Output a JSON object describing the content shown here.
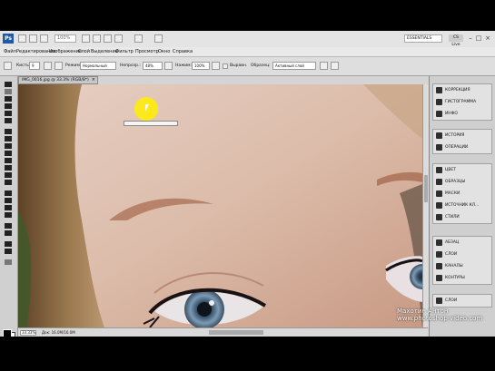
{
  "appbar": {
    "logo": "Ps",
    "zoom": "100%",
    "workspace": "ESSENTIALS",
    "cs_live": "CS Live"
  },
  "menu": [
    "Файл",
    "Редактирование",
    "Изображение",
    "Слой",
    "Выделение",
    "Фильтр",
    "Просмотр",
    "Окно",
    "Справка"
  ],
  "options": {
    "brush_label": "Кисть:",
    "brush_size": "9",
    "mode_label": "Режим:",
    "mode_value": "Нормальный",
    "opacity_label": "Непрозр.:",
    "opacity_value": "48%",
    "flow_label": "Нажим:",
    "flow_value": "100%",
    "aligned_label": "Выравн.",
    "sample_label": "Образец:",
    "sample_value": "Активный слой"
  },
  "document": {
    "tab_title": "IMG_0016.jpg @ 33.3% (RGB/8*)",
    "zoom": "33.33%",
    "info": "Док: 16.0M/16.0M"
  },
  "panels": {
    "group1": [
      {
        "icon": "adjustments-icon",
        "label": "КОРРЕКЦИЯ"
      },
      {
        "icon": "histogram-icon",
        "label": "ГИСТОГРАММА"
      },
      {
        "icon": "info-icon",
        "label": "ИНФО"
      }
    ],
    "group2": [
      {
        "icon": "history-icon",
        "label": "ИСТОРИЯ"
      },
      {
        "icon": "actions-icon",
        "label": "ОПЕРАЦИИ"
      }
    ],
    "group3": [
      {
        "icon": "color-icon",
        "label": "ЦВЕТ"
      },
      {
        "icon": "swatches-icon",
        "label": "ОБРАЗЦЫ"
      },
      {
        "icon": "masks-icon",
        "label": "МАСКИ"
      },
      {
        "icon": "clone-source-icon",
        "label": "ИСТОЧНИК КЛ..."
      },
      {
        "icon": "styles-icon",
        "label": "СТИЛИ"
      }
    ],
    "group4": [
      {
        "icon": "character-icon",
        "label": "АБЗАЦ"
      },
      {
        "icon": "layers-icon",
        "label": "СЛОИ"
      },
      {
        "icon": "channels-icon",
        "label": "КАНАЛЫ"
      },
      {
        "icon": "paths-icon",
        "label": "КОНТУРЫ"
      }
    ],
    "group5": [
      {
        "icon": "layers-comps-icon",
        "label": "СЛОИ"
      }
    ]
  },
  "watermark": {
    "line1": "Махотин Антон",
    "line2": "www.photoshop-video.com"
  },
  "colors": {
    "skin": "#d9b8a8",
    "hair": "#8a6a4a",
    "brow": "#b7826a",
    "iris": "#6f8fa8",
    "highlight": "#ffee00"
  }
}
